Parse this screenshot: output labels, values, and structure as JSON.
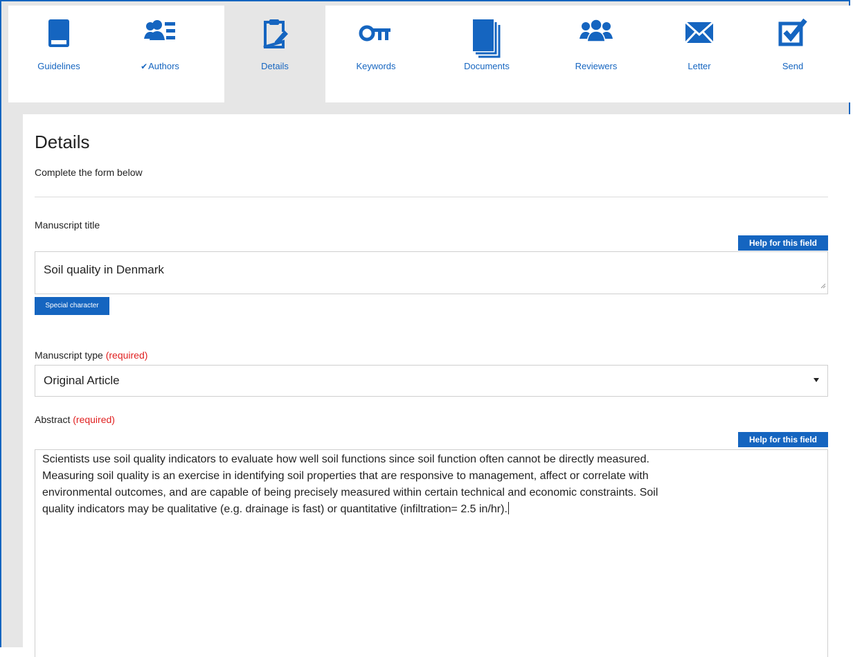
{
  "tabs": [
    {
      "label": "Guidelines",
      "icon": "book-icon",
      "checked": false,
      "active": false
    },
    {
      "label": "Authors",
      "icon": "authors-icon",
      "checked": true,
      "active": false
    },
    {
      "label": "Details",
      "icon": "clipboard-edit-icon",
      "checked": false,
      "active": true
    },
    {
      "label": "Keywords",
      "icon": "key-icon",
      "checked": false,
      "active": false
    },
    {
      "label": "Documents",
      "icon": "documents-icon",
      "checked": false,
      "active": false
    },
    {
      "label": "Reviewers",
      "icon": "reviewers-icon",
      "checked": false,
      "active": false
    },
    {
      "label": "Letter",
      "icon": "envelope-icon",
      "checked": false,
      "active": false
    },
    {
      "label": "Send",
      "icon": "checkbox-icon",
      "checked": false,
      "active": false
    }
  ],
  "check_mark": "✔",
  "page": {
    "title": "Details",
    "subtitle": "Complete the form below"
  },
  "manuscript_title": {
    "label": "Manuscript title",
    "help_label": "Help for this field",
    "value": "Soil quality in Denmark",
    "special_label": "Special character"
  },
  "manuscript_type": {
    "label": "Manuscript type",
    "required_label": "(required)",
    "selected": "Original Article"
  },
  "abstract": {
    "label": "Abstract",
    "required_label": "(required)",
    "help_label": "Help for this field",
    "lines": [
      "Scientists use soil quality indicators to evaluate how well soil functions since soil function often cannot be directly measured.",
      "Measuring soil quality is an exercise in identifying soil properties that are responsive to management, affect or correlate with",
      "environmental outcomes, and are capable of being precisely measured within certain technical and economic constraints. Soil",
      "quality indicators may be qualitative (e.g. drainage is fast) or quantitative (infiltration= 2.5 in/hr)."
    ]
  },
  "colors": {
    "accent": "#1565c0",
    "required": "#e02020",
    "active_tab_bg": "#e6e6e6"
  }
}
